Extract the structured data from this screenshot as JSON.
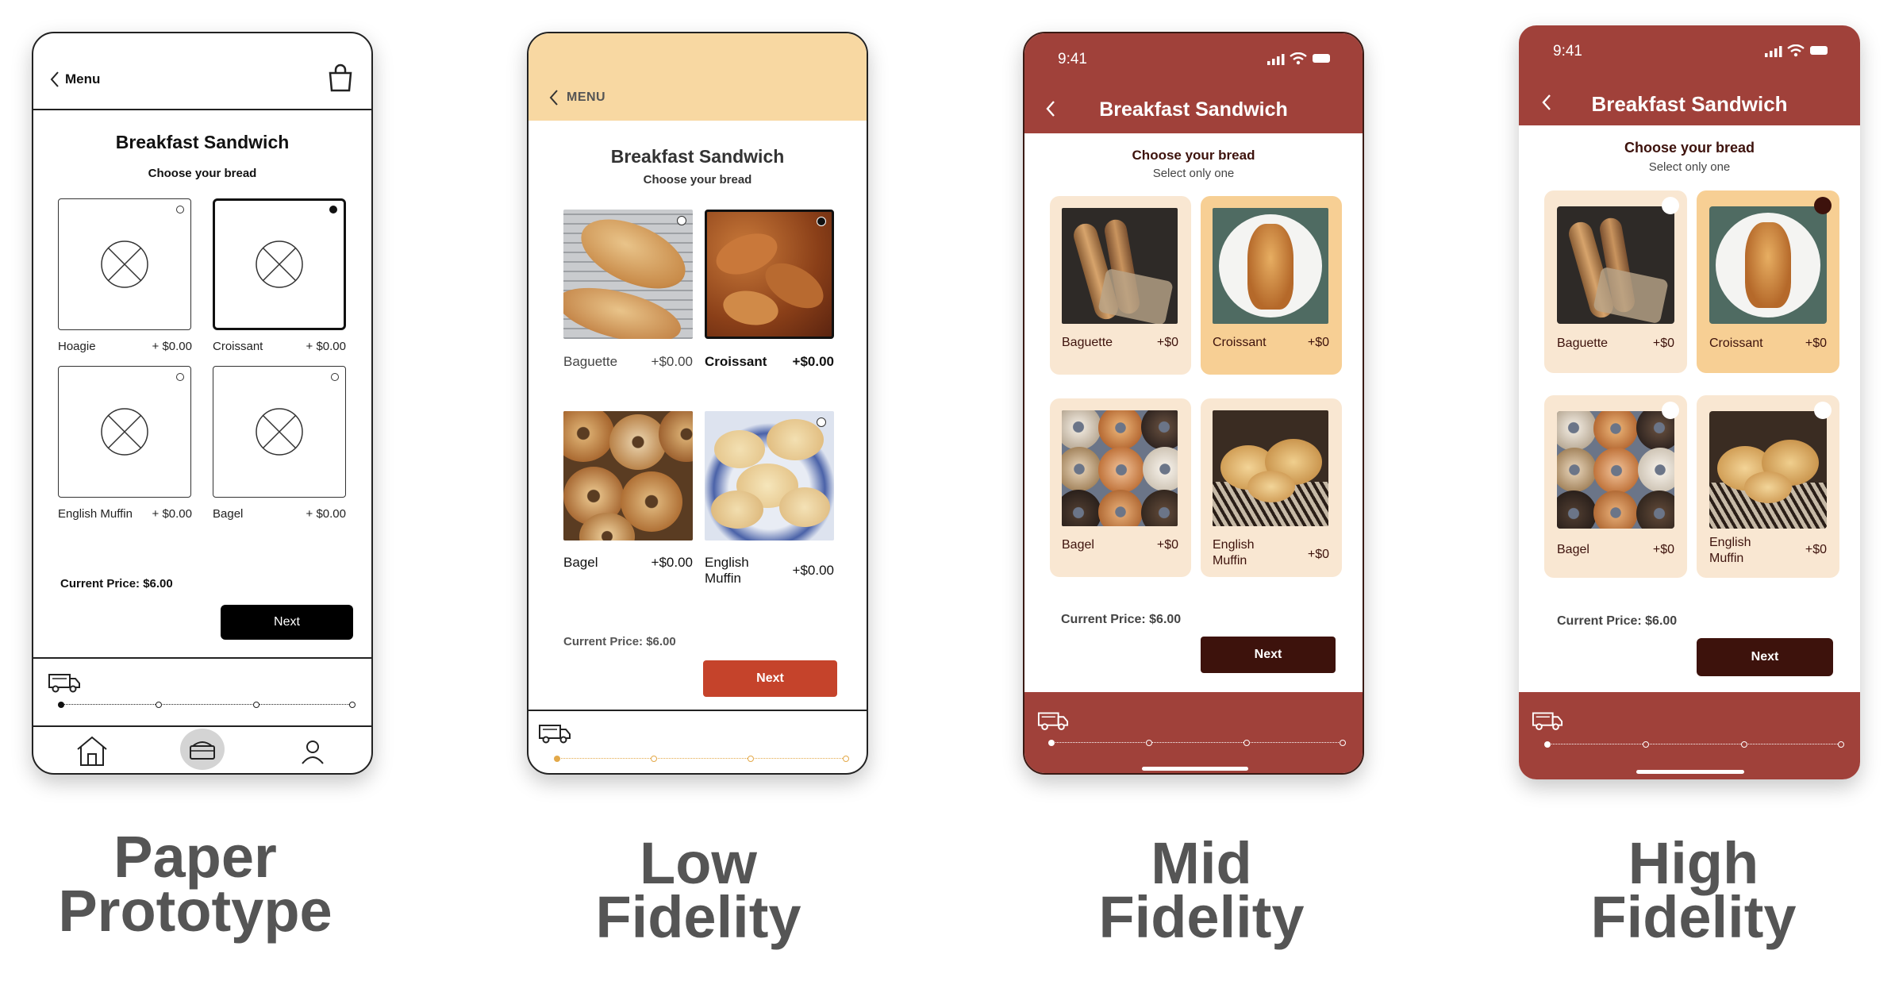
{
  "paper": {
    "back_label": "Menu",
    "title": "Breakfast Sandwich",
    "subtitle": "Choose your bread",
    "options": [
      {
        "name": "Hoagie",
        "price": "+ $0.00"
      },
      {
        "name": "Croissant",
        "price": "+ $0.00"
      },
      {
        "name": "English Muffin",
        "price": "+ $0.00"
      },
      {
        "name": "Bagel",
        "price": "+ $0.00"
      }
    ],
    "current_price": "Current Price: $6.00",
    "next_label": "Next",
    "caption": [
      "Paper",
      "Prototype"
    ]
  },
  "low": {
    "back_label": "MENU",
    "title": "Breakfast Sandwich",
    "subtitle": "Choose your bread",
    "options": [
      {
        "name": "Baguette",
        "price": "+$0.00"
      },
      {
        "name": "Croissant",
        "price": "+$0.00"
      },
      {
        "name": "Bagel",
        "price": "+$0.00"
      },
      {
        "name": "English Muffin",
        "price": "+$0.00"
      }
    ],
    "current_price": "Current Price: $6.00",
    "next_label": "Next",
    "caption": [
      "Low",
      "Fidelity"
    ]
  },
  "mid": {
    "time": "9:41",
    "title": "Breakfast Sandwich",
    "subtitle": "Choose your bread",
    "hint": "Select only one",
    "options": [
      {
        "name": "Baguette",
        "price": "+$0"
      },
      {
        "name": "Croissant",
        "price": "+$0"
      },
      {
        "name": "Bagel",
        "price": "+$0"
      },
      {
        "name": "English Muffin",
        "price": "+$0"
      }
    ],
    "current_price": "Current Price: $6.00",
    "next_label": "Next",
    "caption": [
      "Mid",
      "Fidelity"
    ]
  },
  "high": {
    "time": "9:41",
    "title": "Breakfast Sandwich",
    "subtitle": "Choose your bread",
    "hint": "Select only one",
    "options": [
      {
        "name": "Baguette",
        "price": "+$0"
      },
      {
        "name": "Croissant",
        "price": "+$0"
      },
      {
        "name": "Bagel",
        "price": "+$0"
      },
      {
        "name": "English Muffin",
        "price": "+$0"
      }
    ],
    "current_price": "Current Price: $6.00",
    "next_label": "Next",
    "caption": [
      "High",
      "Fidelity"
    ]
  },
  "colors": {
    "brick": "#a0413a",
    "dark_brown": "#3d120c",
    "cream": "#f9e7d2",
    "tan": "#f7cf94",
    "low_header": "#f8d8a2",
    "low_button": "#c5432b"
  },
  "selected_index": 1
}
